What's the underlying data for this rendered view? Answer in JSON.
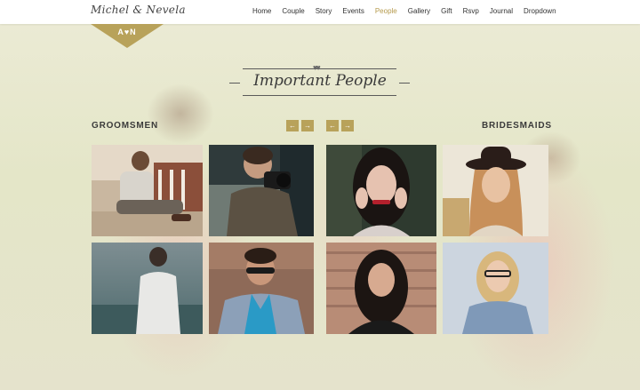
{
  "brand": {
    "logo_text": "Michel & Nevela",
    "monogram": "A♥N"
  },
  "nav": {
    "items": [
      "Home",
      "Couple",
      "Story",
      "Events",
      "People",
      "Gallery",
      "Gift",
      "Rsvp",
      "Journal",
      "Dropdown"
    ],
    "active": "People"
  },
  "section": {
    "title": "Important People",
    "hearts_icon": "hearts-icon"
  },
  "groomsmen": {
    "heading": "GROOMSMEN",
    "prev_icon": "←",
    "next_icon": "→",
    "photos": [
      {
        "name": "groomsman-photo-1"
      },
      {
        "name": "groomsman-photo-2"
      },
      {
        "name": "groomsman-photo-3"
      },
      {
        "name": "groomsman-photo-4"
      }
    ]
  },
  "bridesmaids": {
    "heading": "BRIDESMAIDS",
    "prev_icon": "←",
    "next_icon": "→",
    "photos": [
      {
        "name": "bridesmaid-photo-1"
      },
      {
        "name": "bridesmaid-photo-2"
      },
      {
        "name": "bridesmaid-photo-3"
      },
      {
        "name": "bridesmaid-photo-4"
      }
    ]
  },
  "colors": {
    "accent": "#b8a25a",
    "nav_active": "#b59a4c",
    "text_dark": "#3a3a3a"
  }
}
